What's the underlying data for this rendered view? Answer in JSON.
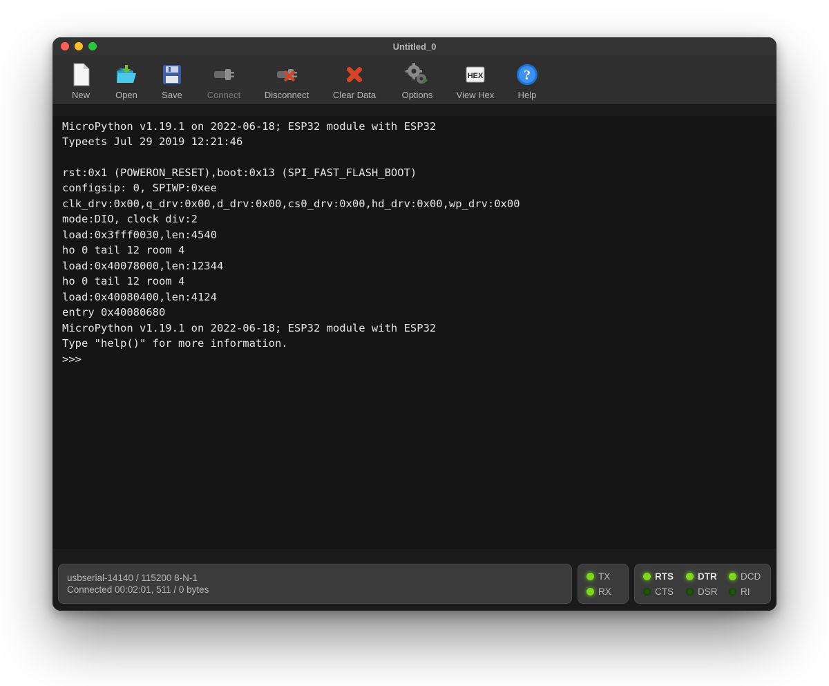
{
  "window": {
    "title": "Untitled_0"
  },
  "toolbar": [
    {
      "id": "new",
      "label": "New",
      "icon": "new-file-icon",
      "enabled": true
    },
    {
      "id": "open",
      "label": "Open",
      "icon": "open-icon",
      "enabled": true
    },
    {
      "id": "save",
      "label": "Save",
      "icon": "save-icon",
      "enabled": true
    },
    {
      "id": "connect",
      "label": "Connect",
      "icon": "connect-icon",
      "enabled": false
    },
    {
      "id": "disconnect",
      "label": "Disconnect",
      "icon": "disconnect-icon",
      "enabled": true
    },
    {
      "id": "clear-data",
      "label": "Clear Data",
      "icon": "clear-icon",
      "enabled": true
    },
    {
      "id": "options",
      "label": "Options",
      "icon": "gear-icon",
      "enabled": true
    },
    {
      "id": "view-hex",
      "label": "View Hex",
      "icon": "hex-icon",
      "enabled": true
    },
    {
      "id": "help",
      "label": "Help",
      "icon": "help-icon",
      "enabled": true
    }
  ],
  "terminal": {
    "lines": [
      "MicroPython v1.19.1 on 2022-06-18; ESP32 module with ESP32",
      "Typeets Jul 29 2019 12:21:46",
      "",
      "rst:0x1 (POWERON_RESET),boot:0x13 (SPI_FAST_FLASH_BOOT)",
      "configsip: 0, SPIWP:0xee",
      "clk_drv:0x00,q_drv:0x00,d_drv:0x00,cs0_drv:0x00,hd_drv:0x00,wp_drv:0x00",
      "mode:DIO, clock div:2",
      "load:0x3fff0030,len:4540",
      "ho 0 tail 12 room 4",
      "load:0x40078000,len:12344",
      "ho 0 tail 12 room 4",
      "load:0x40080400,len:4124",
      "entry 0x40080680",
      "MicroPython v1.19.1 on 2022-06-18; ESP32 module with ESP32",
      "Type \"help()\" for more information.",
      ">>> "
    ]
  },
  "status": {
    "port_line": "usbserial-14140 / 115200 8-N-1",
    "conn_line": "Connected 00:02:01, 511 / 0 bytes",
    "txrx": [
      {
        "name": "TX",
        "on": true
      },
      {
        "name": "RX",
        "on": true
      }
    ],
    "flow": [
      {
        "name": "RTS",
        "on": true,
        "bold": true
      },
      {
        "name": "DTR",
        "on": true,
        "bold": true
      },
      {
        "name": "DCD",
        "on": true,
        "bold": false
      },
      {
        "name": "CTS",
        "on": false,
        "bold": false
      },
      {
        "name": "DSR",
        "on": false,
        "bold": false
      },
      {
        "name": "RI",
        "on": false,
        "bold": false
      }
    ]
  }
}
